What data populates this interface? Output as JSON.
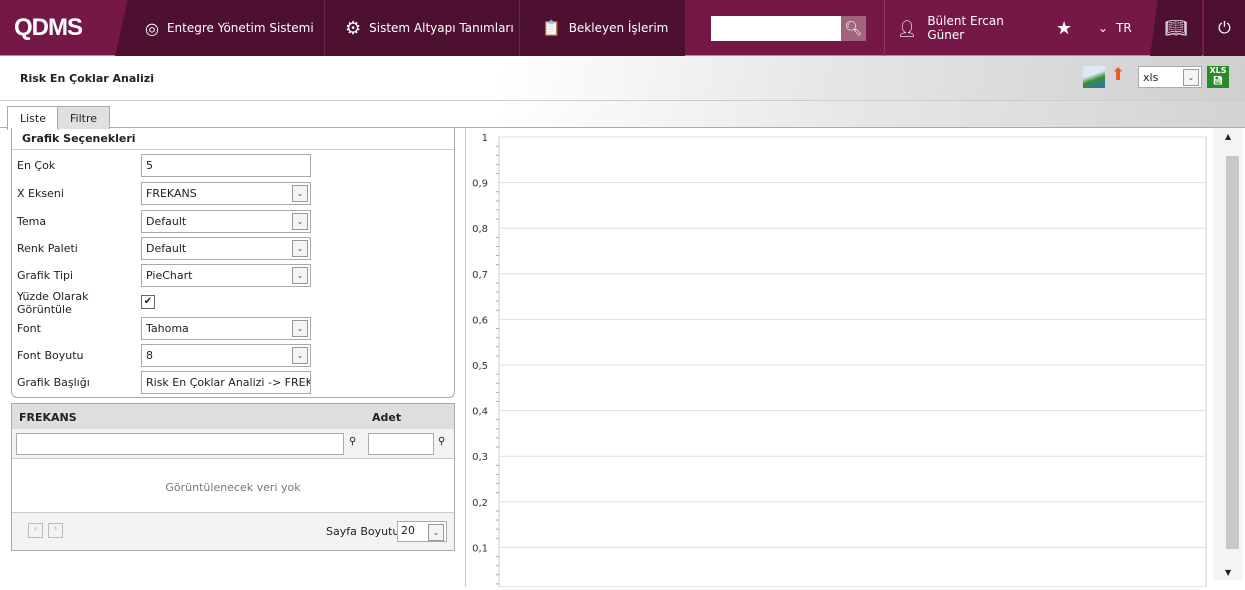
{
  "header": {
    "logo": "QDMS",
    "nav": [
      {
        "label": "Entegre Yönetim Sistemi",
        "icon": "q-logo-icon"
      },
      {
        "label": "Sistem Altyapı Tanımları",
        "icon": "gear-icon"
      },
      {
        "label": "Bekleyen İşlerim",
        "icon": "clipboard-icon"
      }
    ],
    "search_value": "",
    "user": "Bülent Ercan Güner",
    "lang": "TR"
  },
  "page": {
    "title": "Risk En Çoklar Analizi",
    "export_format": "xls"
  },
  "tabs": [
    "Liste",
    "Filtre"
  ],
  "options": {
    "title": "Grafik Seçenekleri",
    "fields": [
      {
        "label": "En Çok",
        "value": "5",
        "type": "input"
      },
      {
        "label": "X Ekseni",
        "value": "FREKANS",
        "type": "select"
      },
      {
        "label": "Tema",
        "value": "Default",
        "type": "select"
      },
      {
        "label": "Renk Paleti",
        "value": "Default",
        "type": "select"
      },
      {
        "label": "Grafik Tipi",
        "value": "PieChart",
        "type": "select"
      },
      {
        "label": "Yüzde Olarak Görüntüle",
        "value": "✔",
        "type": "checkbox"
      },
      {
        "label": "Font",
        "value": "Tahoma",
        "type": "select"
      },
      {
        "label": "Font Boyutu",
        "value": "8",
        "type": "select"
      },
      {
        "label": "Grafik Başlığı",
        "value": "Risk En Çoklar Analizi -> FREKAN",
        "type": "input"
      }
    ]
  },
  "grid": {
    "columns": [
      "FREKANS",
      "Adet"
    ],
    "empty": "Görüntülenecek veri yok",
    "page_size_label": "Sayfa Boyutu:",
    "page_size": "20"
  },
  "chart_data": {
    "type": "pie",
    "title": "",
    "ylim": [
      0,
      1
    ],
    "yticks": [
      "0,1",
      "0,2",
      "0,3",
      "0,4",
      "0,5",
      "0,6",
      "0,7",
      "0,8",
      "0,9",
      "1"
    ],
    "values": []
  }
}
